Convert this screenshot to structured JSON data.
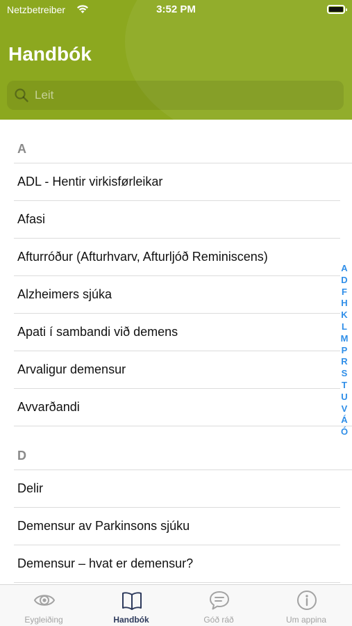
{
  "status_bar": {
    "carrier": "Netzbetreiber",
    "time": "3:52 PM"
  },
  "header": {
    "title": "Handbók"
  },
  "search": {
    "placeholder": "Leit"
  },
  "sections": [
    {
      "letter": "A",
      "items": [
        "ADL - Hentir virkisførleikar",
        "Afasi",
        "Afturróður (Afturhvarv, Afturljóð Reminiscens)",
        "Alzheimers sjúka",
        "Apati í sambandi við demens",
        "Arvaligur demensur",
        "Avvarðandi"
      ]
    },
    {
      "letter": "D",
      "items": [
        "Delir",
        "Demensur av Parkinsons sjúku",
        "Demensur – hvat er demensur?"
      ]
    }
  ],
  "index_letters": [
    "A",
    "D",
    "F",
    "H",
    "K",
    "L",
    "M",
    "P",
    "R",
    "S",
    "T",
    "U",
    "V",
    "Á",
    "Ó"
  ],
  "tabs": [
    {
      "label": "Eygleiðing",
      "icon": "eye-icon",
      "active": false
    },
    {
      "label": "Handbók",
      "icon": "book-icon",
      "active": true
    },
    {
      "label": "Góð ráð",
      "icon": "chat-bubble-icon",
      "active": false
    },
    {
      "label": "Um appina",
      "icon": "info-icon",
      "active": false
    }
  ],
  "colors": {
    "header": "#8ca81f",
    "index": "#2f8ee8",
    "tab_active": "#2d3a5c",
    "tab_inactive": "#a3a3a3"
  }
}
